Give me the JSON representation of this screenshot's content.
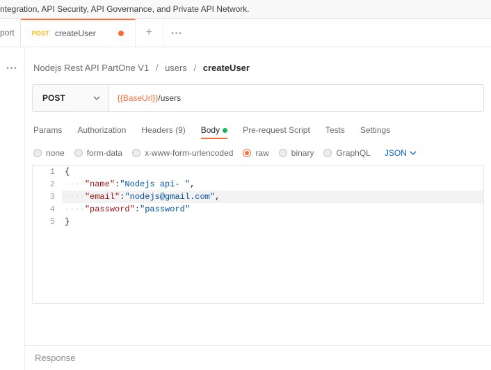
{
  "top_banner": "ntegration, API Security, API Governance, and Private API Network.",
  "tabs": {
    "left_stub": "port",
    "active": {
      "method": "POST",
      "title": "createUser"
    }
  },
  "breadcrumb": {
    "part1": "Nodejs Rest API PartOne V1",
    "part2": "users",
    "current": "createUser"
  },
  "request": {
    "method": "POST",
    "url_var": "{{BaseUrl}}",
    "url_rest": "/users"
  },
  "subTabs": {
    "params": "Params",
    "authorization": "Authorization",
    "headers": "Headers (9)",
    "body": "Body",
    "prerequest": "Pre-request Script",
    "tests": "Tests",
    "settings": "Settings"
  },
  "bodyTypes": {
    "none": "none",
    "formdata": "form-data",
    "xwww": "x-www-form-urlencoded",
    "raw": "raw",
    "binary": "binary",
    "graphql": "GraphQL",
    "lang": "JSON"
  },
  "code": {
    "l1": "{",
    "l2_key": "\"name\"",
    "l2_val": "\"Nodejs api- \"",
    "l3_key": "\"email\"",
    "l3_val": "\"nodejs@gmail.com\"",
    "l4_key": "\"password\"",
    "l4_val": "\"password\"",
    "l5": "}",
    "ws": "····"
  },
  "response_label": "Response"
}
